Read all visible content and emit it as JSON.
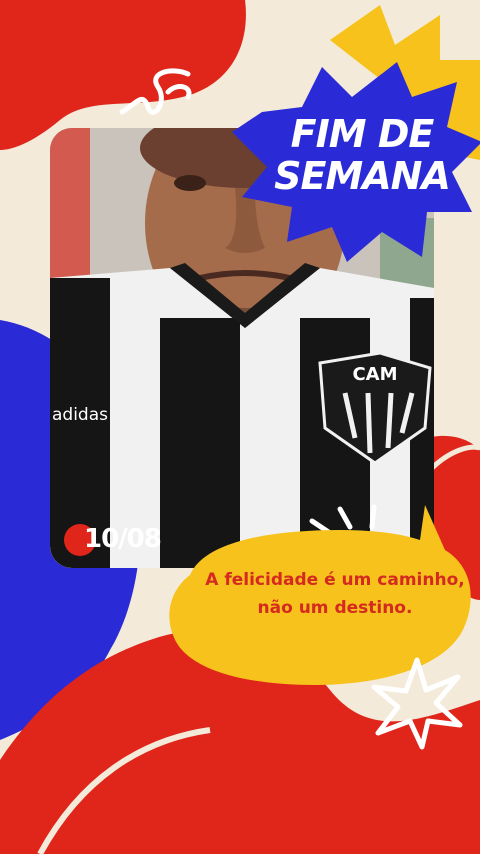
{
  "story": {
    "headline_line1": "FIM DE",
    "headline_line2": "SEMANA",
    "date": "10/08",
    "quote_line1": "A felicidade é um caminho,",
    "quote_line2": "não um destino."
  },
  "photo": {
    "jersey_crest_text": "CAM",
    "jersey_brand_text": "adidas"
  },
  "colors": {
    "background": "#f3ead9",
    "red": "#e0251b",
    "blue": "#2a2ad6",
    "yellow": "#f6c21b",
    "white": "#ffffff"
  },
  "icons": [
    "swirl-doodle-icon",
    "star-outline-icon",
    "sparkle-lines-icon"
  ]
}
